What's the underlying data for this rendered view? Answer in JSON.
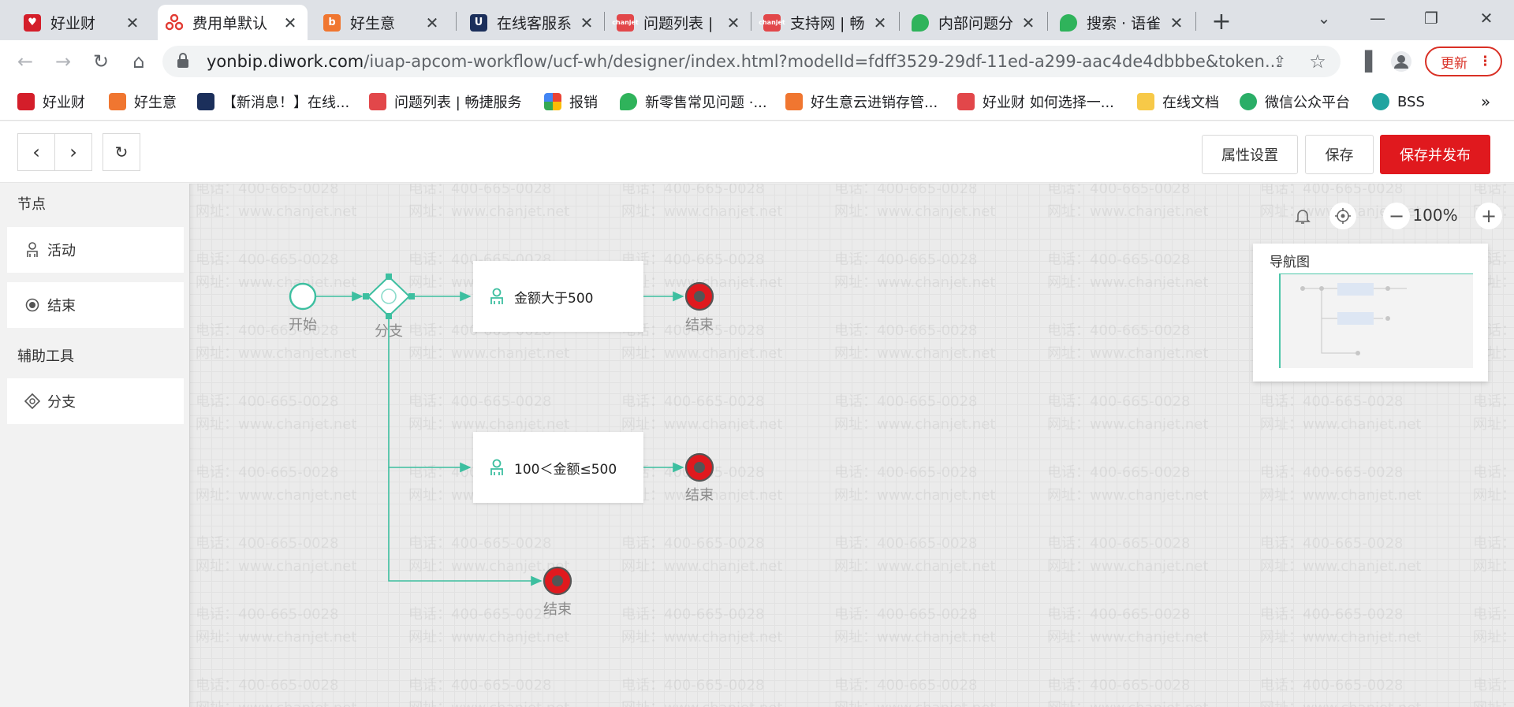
{
  "browser": {
    "tabs": [
      {
        "title": "好业财",
        "favicon": "haoyecai-icon",
        "color": "#d41e2a",
        "active": false
      },
      {
        "title": "费用单默认",
        "favicon": "flower-icon",
        "color": "#e23b33",
        "active": true
      },
      {
        "title": "好生意",
        "favicon": "haoshengyi-icon",
        "color": "#f07630",
        "active": false
      },
      {
        "title": "在线客服系",
        "favicon": "udesk-icon",
        "color": "#1b2f5b",
        "active": false
      },
      {
        "title": "问题列表 |",
        "favicon": "chanjet-icon",
        "color": "#e2474a",
        "active": false
      },
      {
        "title": "支持网 | 畅",
        "favicon": "chanjet-icon",
        "color": "#e2474a",
        "active": false
      },
      {
        "title": "内部问题分",
        "favicon": "yuque-icon",
        "color": "#2fb35b",
        "active": false
      },
      {
        "title": "搜索 · 语雀",
        "favicon": "yuque-icon",
        "color": "#2fb35b",
        "active": false
      }
    ],
    "url": {
      "host": "yonbip.diwork.com",
      "path": "/iuap-apcom-workflow/ucf-wh/designer/index.html?modelId=fdff3529-29df-11ed-a299-aac4de4dbbbe&token..."
    },
    "update_label": "更新",
    "bookmarks": [
      {
        "label": "好业财",
        "favicon": "haoyecai-icon",
        "color": "#d41e2a"
      },
      {
        "label": "好生意",
        "favicon": "haoshengyi-icon",
        "color": "#f07630"
      },
      {
        "label": "【新消息！】在线...",
        "favicon": "udesk-icon",
        "color": "#1b2f5b"
      },
      {
        "label": "问题列表 | 畅捷服务",
        "favicon": "chanjet-icon",
        "color": "#e2474a"
      },
      {
        "label": "报销",
        "favicon": "pinwheel-icon",
        "color": "#34a853"
      },
      {
        "label": "新零售常见问题 ·...",
        "favicon": "yuque-icon",
        "color": "#2fb35b"
      },
      {
        "label": "好生意云进销存管...",
        "favicon": "haoshengyi-icon",
        "color": "#f07630"
      },
      {
        "label": "好业财 如何选择一...",
        "favicon": "chanjet-icon",
        "color": "#e2474a"
      },
      {
        "label": "在线文档",
        "favicon": "folder-icon",
        "color": "#f7c948"
      },
      {
        "label": "微信公众平台",
        "favicon": "wechat-icon",
        "color": "#2aae67"
      },
      {
        "label": "BSS",
        "favicon": "gear-icon",
        "color": "#20a4a0"
      }
    ],
    "more_bookmarks": "»"
  },
  "app": {
    "header": {
      "property_label": "属性设置",
      "save_label": "保存",
      "save_publish_label": "保存并发布"
    },
    "palette": {
      "nodes_title": "节点",
      "nodes": [
        {
          "label": "活动",
          "icon": "user-icon"
        },
        {
          "label": "结束",
          "icon": "end-radio-icon"
        }
      ],
      "tools_title": "辅助工具",
      "tools": [
        {
          "label": "分支",
          "icon": "diamond-icon"
        }
      ]
    },
    "canvas": {
      "zoom": "100%",
      "minimap_title": "导航图",
      "watermark_phone": "电话：400-665-0028",
      "watermark_site": "网址：www.chanjet.net",
      "flow": {
        "start_label": "开始",
        "branch_label": "分支",
        "task1_label": "金额大于500",
        "task2_label": "100＜金额≤500",
        "end_label": "结束"
      },
      "accent": "#3dbfa0",
      "end_color": "#e0191e"
    }
  }
}
